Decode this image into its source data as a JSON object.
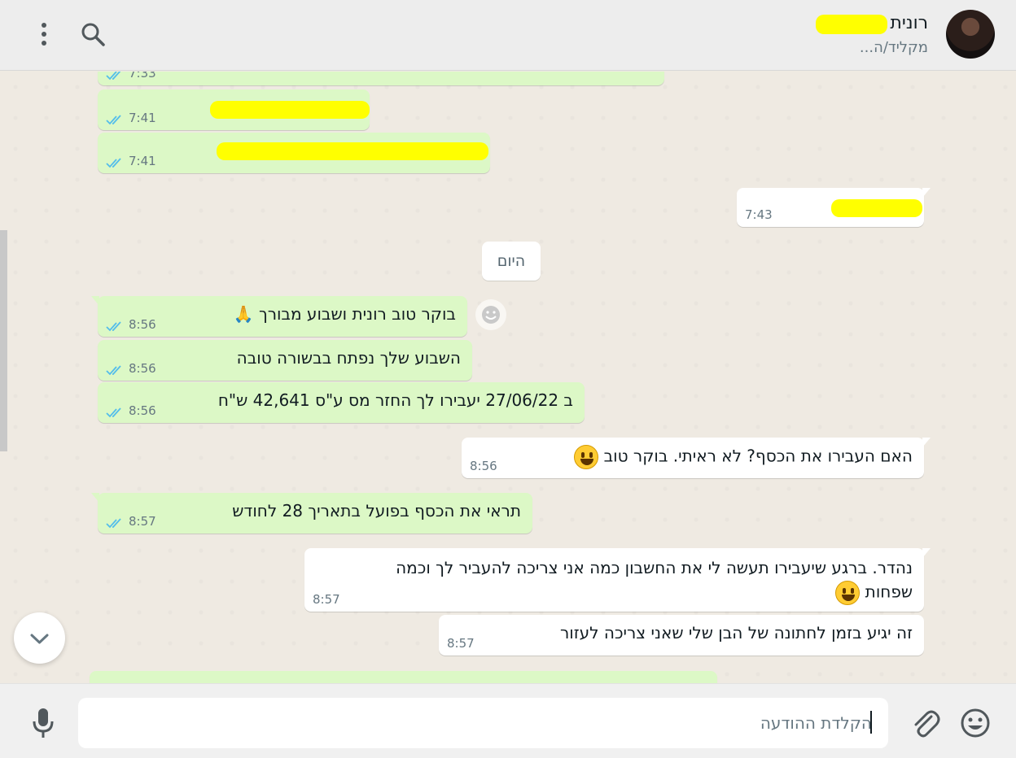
{
  "header": {
    "contact_name": "רונית",
    "status": "מקליד/ה...",
    "menu_icon": "vertical-dots-icon",
    "search_icon": "search-icon"
  },
  "chat": {
    "date_divider": "היום",
    "messages": [
      {
        "direction": "out",
        "text": "",
        "time": "7:33",
        "status": "read"
      },
      {
        "direction": "out",
        "text": "",
        "time": "7:41",
        "status": "read"
      },
      {
        "direction": "out",
        "text": "",
        "time": "7:41",
        "status": "read"
      },
      {
        "direction": "in",
        "text": "",
        "time": "7:43"
      },
      {
        "direction": "out",
        "text": "בוקר טוב רונית ושבוע מבורך 🙏",
        "time": "8:56",
        "status": "read"
      },
      {
        "direction": "out",
        "text": "השבוע שלך נפתח בבשורה טובה",
        "time": "8:56",
        "status": "read"
      },
      {
        "direction": "out",
        "text": "ב 27/06/22 יעבירו לך החזר מס ע\"ס 42,641 ש\"ח",
        "time": "8:56",
        "status": "read"
      },
      {
        "direction": "in",
        "text": "האם העבירו את הכסף? לא ראיתי. בוקר טוב",
        "time": "8:56"
      },
      {
        "direction": "out",
        "text": "תראי את הכסף בפועל בתאריך 28 לחודש",
        "time": "8:57",
        "status": "read"
      },
      {
        "direction": "in",
        "line1": "נהדר. ברגע שיעבירו תעשה לי את החשבון כמה אני צריכה להעביר לך וכמה",
        "line2": "שפחות",
        "time": "8:57"
      },
      {
        "direction": "in",
        "text": "זה יגיע בזמן לחתונה של הבן שלי שאני צריכה לעזור",
        "time": "8:57"
      }
    ]
  },
  "composer": {
    "placeholder": "הקלדת ההודעה",
    "mic_icon": "microphone-icon",
    "attach_icon": "paperclip-icon",
    "emoji_icon": "smiley-icon"
  },
  "colors": {
    "outgoing_bubble": "#dcf8c6",
    "incoming_bubble": "#ffffff",
    "chat_background": "#efeae2",
    "read_ticks": "#53bdeb",
    "redaction": "#ffff00"
  }
}
